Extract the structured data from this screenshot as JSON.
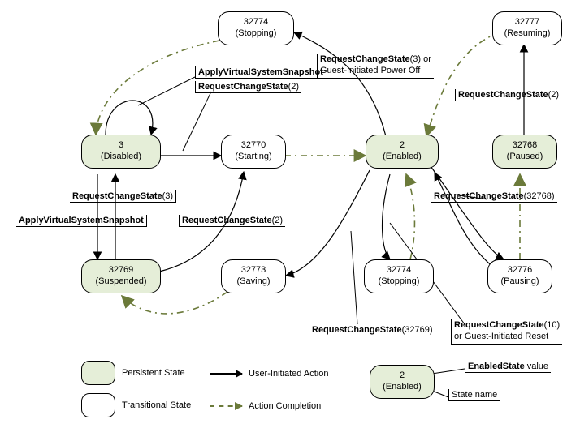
{
  "chart_data": {
    "type": "state-diagram",
    "states": [
      {
        "id": "3",
        "name": "Disabled",
        "persistent": true
      },
      {
        "id": "32769",
        "name": "Suspended",
        "persistent": true
      },
      {
        "id": "2",
        "name": "Enabled",
        "persistent": true
      },
      {
        "id": "32768",
        "name": "Paused",
        "persistent": true
      },
      {
        "id": "32774",
        "name": "Stopping",
        "persistent": false
      },
      {
        "id": "32770",
        "name": "Starting",
        "persistent": false
      },
      {
        "id": "32773",
        "name": "Saving",
        "persistent": false
      },
      {
        "id": "32774",
        "name": "Stopping",
        "persistent": false
      },
      {
        "id": "32776",
        "name": "Pausing",
        "persistent": false
      },
      {
        "id": "32777",
        "name": "Resuming",
        "persistent": false
      }
    ],
    "transitions": [
      {
        "from": "Disabled",
        "to": "Disabled",
        "label": "ApplyVirtualSystemSnapshot",
        "kind": "user"
      },
      {
        "from": "Disabled",
        "to": "Starting",
        "label": "RequestChangeState(2)",
        "kind": "user"
      },
      {
        "from": "Disabled",
        "to": "Suspended",
        "label": "ApplyVirtualSystemSnapshot",
        "kind": "user"
      },
      {
        "from": "Suspended",
        "to": "Disabled",
        "label": "RequestChangeState(3)",
        "kind": "user"
      },
      {
        "from": "Suspended",
        "to": "Starting",
        "label": "RequestChangeState(2)",
        "kind": "user"
      },
      {
        "from": "Starting",
        "to": "Enabled",
        "label": "",
        "kind": "completion"
      },
      {
        "from": "Enabled",
        "to": "Stopping(top)",
        "label": "RequestChangeState(3) or Guest-Initiated Power Off",
        "kind": "user"
      },
      {
        "from": "Stopping(top)",
        "to": "Disabled",
        "label": "",
        "kind": "completion"
      },
      {
        "from": "Enabled",
        "to": "Saving",
        "label": "RequestChangeState(32769)",
        "kind": "user"
      },
      {
        "from": "Saving",
        "to": "Suspended",
        "label": "",
        "kind": "completion"
      },
      {
        "from": "Enabled",
        "to": "Stopping(mid)",
        "label": "RequestChangeState(10) or Guest-Initiated Reset",
        "kind": "user"
      },
      {
        "from": "Stopping(mid)",
        "to": "Enabled",
        "label": "",
        "kind": "completion"
      },
      {
        "from": "Enabled",
        "to": "Pausing",
        "label": "RequestChangeState(32768)",
        "kind": "user"
      },
      {
        "from": "Pausing",
        "to": "Paused",
        "label": "",
        "kind": "completion"
      },
      {
        "from": "Paused",
        "to": "Resuming",
        "label": "RequestChangeState(2)",
        "kind": "user"
      },
      {
        "from": "Resuming",
        "to": "Enabled",
        "label": "",
        "kind": "completion"
      }
    ]
  },
  "states": {
    "disabled": {
      "id": "3",
      "name": "(Disabled)"
    },
    "suspended": {
      "id": "32769",
      "name": "(Suspended)"
    },
    "enabled": {
      "id": "2",
      "name": "(Enabled)"
    },
    "paused": {
      "id": "32768",
      "name": "(Paused)"
    },
    "stoppingTop": {
      "id": "32774",
      "name": "(Stopping)"
    },
    "starting": {
      "id": "32770",
      "name": "(Starting)"
    },
    "saving": {
      "id": "32773",
      "name": "(Saving)"
    },
    "stoppingMid": {
      "id": "32774",
      "name": "(Stopping)"
    },
    "pausing": {
      "id": "32776",
      "name": "(Pausing)"
    },
    "resuming": {
      "id": "32777",
      "name": "(Resuming)"
    }
  },
  "labels": {
    "applySnap1": "ApplyVirtualSystemSnapshot",
    "rcs2a": "(2)",
    "rcs2a_pre": "RequestChangeState",
    "rcs3a": "(3)",
    "rcs3a_pre": "RequestChangeState",
    "applySnap2": "ApplyVirtualSystemSnapshot",
    "rcs2b": "(2)",
    "rcs2b_pre": "RequestChangeState",
    "rcs3OrOff_line1_pre": "RequestChangeState",
    "rcs3OrOff_line1_arg": "(3) or",
    "rcs3OrOff_line2": "Guest-Initiated Power Off",
    "rcs2c_pre": "RequestChangeState",
    "rcs2c": "(2)",
    "rcs32768_pre": "RequestChangeState",
    "rcs32768": "(32768)",
    "rcs32769_pre": "RequestChangeState",
    "rcs32769": "(32769)",
    "rcs10_line1_pre": "RequestChangeState",
    "rcs10_line1_arg": "(10)",
    "rcs10_line2": "or Guest-Initiated Reset"
  },
  "legend": {
    "persistent": "Persistent State",
    "transitional": "Transitional State",
    "userAction": "User-Initiated Action",
    "completion": "Action Completion",
    "enabledStateValue": " value",
    "enabledStateValue_pre": "EnabledState",
    "stateName": "State name",
    "sample": {
      "id": "2",
      "name": "(Enabled)"
    }
  }
}
